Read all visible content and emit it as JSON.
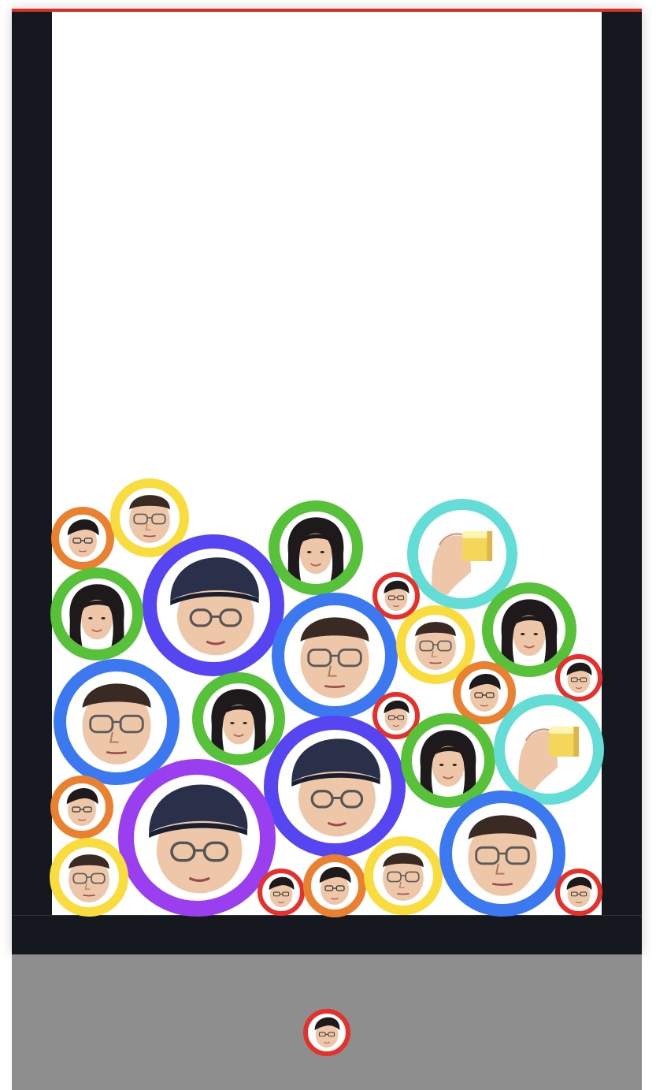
{
  "game": {
    "next_ball": {
      "tier": "red",
      "person": "boy"
    }
  },
  "colors": {
    "frame": "#161820",
    "deadline": "#e02b24",
    "tray": "#8e8e8e",
    "tiers": {
      "red": "#e5302b",
      "orange": "#ea8130",
      "yellow": "#f9dc3e",
      "green": "#57c13a",
      "teal": "#63ddd5",
      "blue": "#3c78f0",
      "indigo": "#5645f0",
      "purple": "#9a3ff0"
    },
    "skin": "#eec6a8",
    "hair": "#1e1a1c",
    "cap": "#2a3049",
    "block": "#f3d65a"
  },
  "balls": [
    {
      "tier": "orange",
      "person": "boy",
      "icon": "boy-face-icon"
    },
    {
      "tier": "yellow",
      "person": "man",
      "icon": "man-glasses-face-icon"
    },
    {
      "tier": "indigo",
      "person": "cap-man",
      "icon": "cap-man-face-icon"
    },
    {
      "tier": "green",
      "person": "girl",
      "icon": "girl-face-icon"
    },
    {
      "tier": "teal",
      "person": "hand",
      "icon": "hand-block-icon"
    },
    {
      "tier": "green",
      "person": "girl",
      "icon": "girl-face-icon"
    },
    {
      "tier": "red",
      "person": "boy",
      "icon": "boy-face-icon"
    },
    {
      "tier": "blue",
      "person": "man",
      "icon": "man-glasses-face-icon"
    },
    {
      "tier": "yellow",
      "person": "man",
      "icon": "man-glasses-face-icon"
    },
    {
      "tier": "green",
      "person": "girl",
      "icon": "girl-face-icon"
    },
    {
      "tier": "red",
      "person": "boy",
      "icon": "boy-face-icon"
    },
    {
      "tier": "blue",
      "person": "man",
      "icon": "man-glasses-face-icon"
    },
    {
      "tier": "green",
      "person": "girl",
      "icon": "girl-face-icon"
    },
    {
      "tier": "orange",
      "person": "boy",
      "icon": "boy-face-icon"
    },
    {
      "tier": "red",
      "person": "boy",
      "icon": "boy-face-icon"
    },
    {
      "tier": "indigo",
      "person": "cap-man",
      "icon": "cap-man-face-icon"
    },
    {
      "tier": "green",
      "person": "girl",
      "icon": "girl-face-icon"
    },
    {
      "tier": "teal",
      "person": "hand",
      "icon": "hand-block-icon"
    },
    {
      "tier": "orange",
      "person": "boy",
      "icon": "boy-face-icon"
    },
    {
      "tier": "purple",
      "person": "cap-man",
      "icon": "cap-man-face-icon"
    },
    {
      "tier": "yellow",
      "person": "man",
      "icon": "man-glasses-face-icon"
    },
    {
      "tier": "red",
      "person": "boy",
      "icon": "boy-face-icon"
    },
    {
      "tier": "orange",
      "person": "boy",
      "icon": "boy-face-icon"
    },
    {
      "tier": "yellow",
      "person": "man",
      "icon": "man-glasses-face-icon"
    },
    {
      "tier": "blue",
      "person": "man",
      "icon": "man-glasses-face-icon"
    },
    {
      "tier": "red",
      "person": "boy",
      "icon": "boy-face-icon"
    }
  ]
}
